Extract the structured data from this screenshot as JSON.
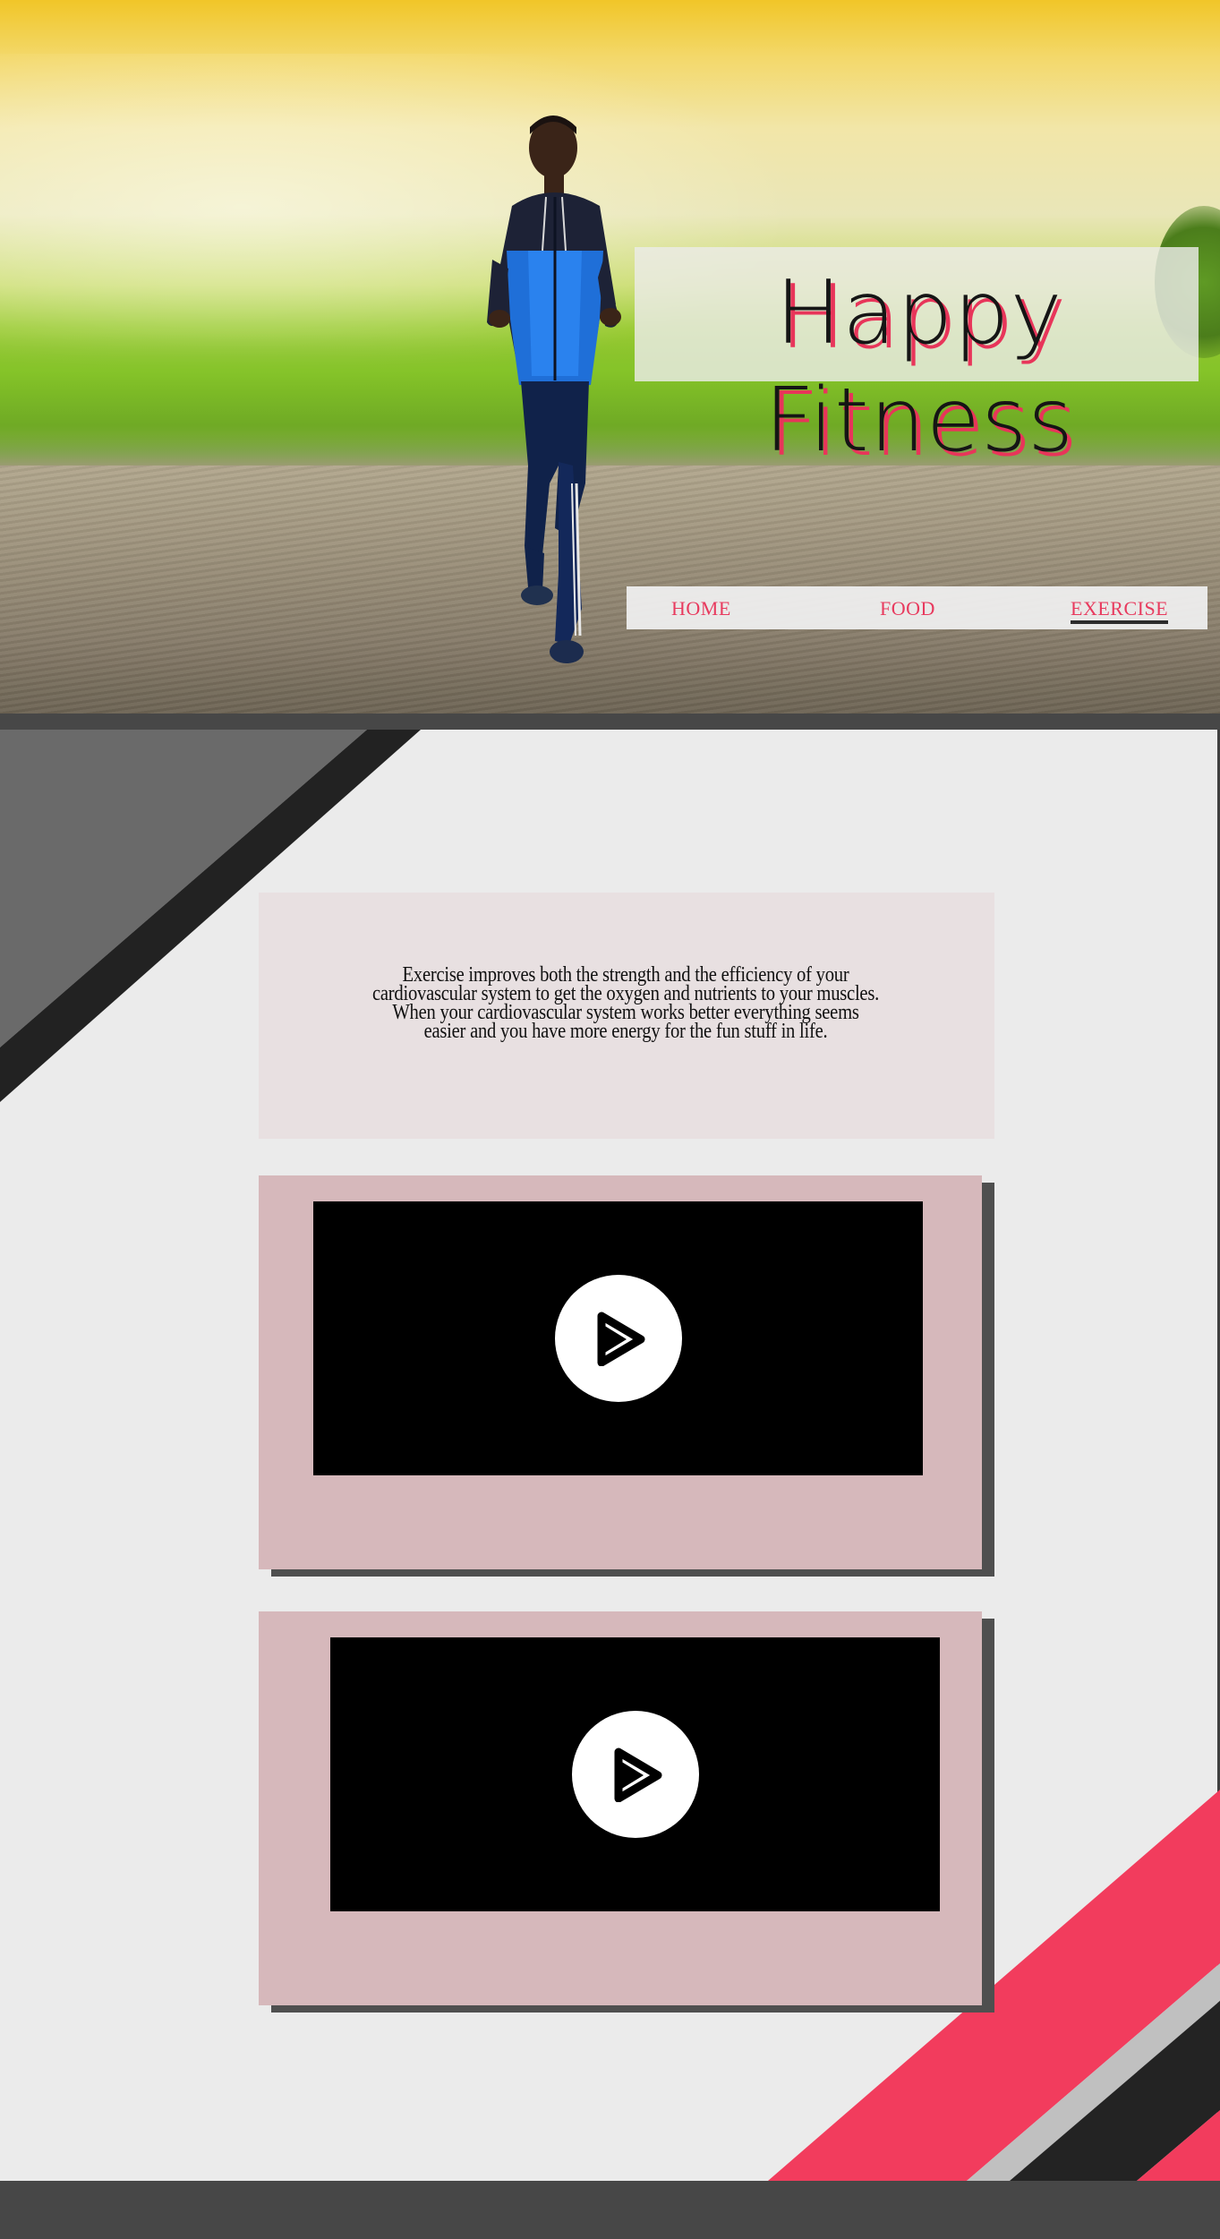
{
  "hero": {
    "title": "Happy Fitness"
  },
  "nav": {
    "items": [
      {
        "label": "HOME",
        "active": false
      },
      {
        "label": "FOOD",
        "active": false
      },
      {
        "label": "EXERCISE",
        "active": true
      }
    ]
  },
  "intro": {
    "text": "Exercise improves both the strength and the efficiency of your cardiovascular system to get the oxygen and nutrients to your muscles.  When your cardiovascular system works better everything seems easier and you have more energy for the fun stuff in life."
  },
  "videos": [
    {
      "icon": "play-icon"
    },
    {
      "icon": "play-icon"
    }
  ],
  "colors": {
    "accent": "#e8355a",
    "card": "#d6b8bb",
    "panel": "#e8e0e1",
    "band": "#474747",
    "background": "#ebebeb"
  }
}
